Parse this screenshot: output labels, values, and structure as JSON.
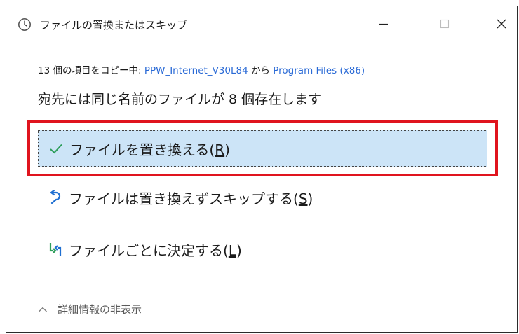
{
  "window": {
    "title": "ファイルの置換またはスキップ",
    "controls": {
      "minimize_icon": "minimize-icon",
      "maximize_icon": "maximize-icon",
      "close_icon": "close-icon"
    }
  },
  "copy_status": {
    "prefix": "13 個の項目をコピー中: ",
    "source": "PPW_Internet_V30L84",
    "middle": " から ",
    "destination": "Program Files (x86)"
  },
  "summary": "宛先には同じ名前のファイルが 8 個存在します",
  "options": [
    {
      "icon": "check-icon",
      "label": "ファイルを置き換える",
      "mnemonic_open": "(",
      "mnemonic_key": "R",
      "mnemonic_close": ")",
      "selected": true
    },
    {
      "icon": "undo-arrow-icon",
      "label": "ファイルは置き換えずスキップする",
      "mnemonic_open": "(",
      "mnemonic_key": "S",
      "mnemonic_close": ")",
      "selected": false
    },
    {
      "icon": "compare-files-icon",
      "label": "ファイルごとに決定する",
      "mnemonic_open": "(",
      "mnemonic_key": "L",
      "mnemonic_close": ")",
      "selected": false
    }
  ],
  "details_toggle": {
    "icon": "chevron-up-icon",
    "label": "詳細情報の非表示"
  },
  "colors": {
    "link": "#2a6ad6",
    "selected_bg": "#cce4f7",
    "highlight_border": "#e0141e",
    "check_green": "#2e9e5b",
    "skip_blue": "#1f6fd1"
  }
}
